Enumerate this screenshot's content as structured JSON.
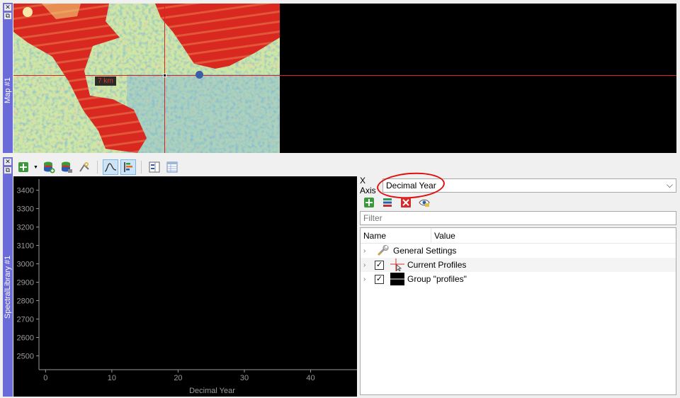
{
  "map": {
    "title": "Map #1",
    "crosshair_label": "7 km",
    "dock_close": "✕",
    "dock_float": "⧉"
  },
  "spectral_library": {
    "title": "SpectralLibrary #1",
    "dock_close": "✕",
    "dock_float": "⧉"
  },
  "toolbar": {
    "icons": [
      "add-profile-icon",
      "dropdown-icon",
      "add-layer-icon",
      "remove-layer-icon",
      "spectral-processing-icon",
      "profile-view-icon",
      "band-view-icon",
      "layout-icon",
      "table-icon"
    ]
  },
  "settings": {
    "x_axis_label": "X Axis",
    "x_axis_value": "Decimal Year",
    "filter_placeholder": "Filter",
    "columns": {
      "name": "Name",
      "value": "Value"
    },
    "rows": [
      {
        "label": "General Settings",
        "icon": "wrench-icon",
        "checkable": false
      },
      {
        "label": "Current Profiles",
        "icon": "crosshair-cursor-icon",
        "checkable": true,
        "checked": true
      },
      {
        "label": "Group \"profiles\"",
        "icon": "black-line-icon",
        "checkable": true,
        "checked": true
      }
    ],
    "highlight_color": "#e01010"
  },
  "chart_data": {
    "type": "line",
    "xlabel": "Decimal Year",
    "ylabel": "",
    "xlim": [
      -1,
      47
    ],
    "ylim": [
      2425,
      3460
    ],
    "x_ticks": [
      0,
      10,
      20,
      30,
      40
    ],
    "y_ticks": [
      2500,
      2600,
      2700,
      2800,
      2900,
      3000,
      3100,
      3200,
      3300,
      3400
    ],
    "series": [],
    "background": "#000000",
    "axis_color": "#9a9a9a"
  }
}
